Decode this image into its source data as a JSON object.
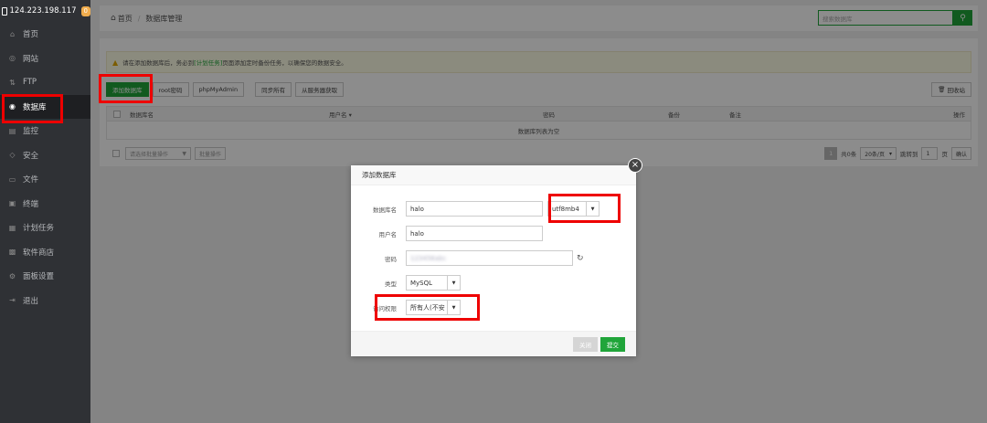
{
  "sidebar": {
    "host": "124.223.198.117",
    "badge": "0",
    "items": [
      {
        "label": "首页",
        "icon": "home-icon"
      },
      {
        "label": "网站",
        "icon": "globe-icon"
      },
      {
        "label": "FTP",
        "icon": "ftp-icon"
      },
      {
        "label": "数据库",
        "icon": "database-icon"
      },
      {
        "label": "监控",
        "icon": "monitor-icon"
      },
      {
        "label": "安全",
        "icon": "shield-icon"
      },
      {
        "label": "文件",
        "icon": "folder-icon"
      },
      {
        "label": "终端",
        "icon": "terminal-icon"
      },
      {
        "label": "计划任务",
        "icon": "calendar-icon"
      },
      {
        "label": "软件商店",
        "icon": "grid-icon"
      },
      {
        "label": "面板设置",
        "icon": "gear-icon"
      },
      {
        "label": "退出",
        "icon": "logout-icon"
      }
    ]
  },
  "breadcrumb": {
    "home": "首页",
    "sep": "/",
    "current": "数据库管理"
  },
  "search": {
    "placeholder": "搜索数据库"
  },
  "notice": {
    "prefix": "请在添加数据库后，务必到",
    "link": "[计划任务]",
    "suffix": "页面添加定时备份任务，以确保您的数据安全。"
  },
  "toolbar": {
    "add": "添加数据库",
    "root_pw": "root密码",
    "phpmyadmin": "phpMyAdmin",
    "sync_all": "同步所有",
    "fetch_server": "从服务器获取",
    "recycle": "回收站"
  },
  "table": {
    "headers": {
      "name": "数据库名",
      "user": "用户名 ▾",
      "password": "密码",
      "backup": "备份",
      "remark": "备注",
      "action": "操作"
    },
    "empty": "数据库列表为空"
  },
  "footer": {
    "batch_select": "请选择批量操作",
    "batch_btn": "批量操作",
    "page": "1",
    "total": "共0条",
    "per_page": "20条/页",
    "jump": "跳转到",
    "jump_val": "1",
    "page_unit": "页",
    "confirm": "确认"
  },
  "modal": {
    "title": "添加数据库",
    "close": "×",
    "db_name_label": "数据库名",
    "db_name_value": "halo",
    "charset": "utf8mb4",
    "user_label": "用户名",
    "user_value": "halo",
    "password_label": "密码",
    "password_value": "123456abc",
    "type_label": "类型",
    "type_value": "MySQL",
    "access_label": "访问权限",
    "access_value": "所有人(不安",
    "cancel": "关闭",
    "submit": "提交"
  },
  "colors": {
    "brand": "#20a53a",
    "sidebar": "#2f3135",
    "highlight": "#e00000"
  }
}
